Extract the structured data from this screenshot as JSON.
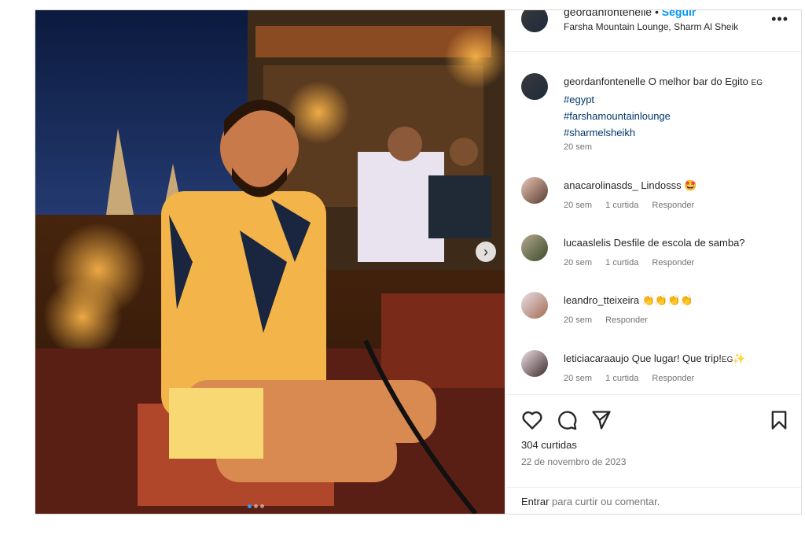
{
  "post": {
    "header": {
      "username": "geordanfontenelle",
      "separator": "•",
      "follow": "Seguir",
      "location": "Farsha Mountain Lounge, Sharm Al Sheik",
      "more_icon": "more-horizontal-icon"
    },
    "caption": {
      "username": "geordanfontenelle",
      "text": "O melhor bar do Egito",
      "flag": "EG",
      "tags": [
        "#egypt",
        "#farshamountainlounge",
        "#sharmelsheikh"
      ],
      "time": "20 sem"
    },
    "comments": [
      {
        "username": "anacarolinasds_",
        "text": "Lindosss",
        "emoji": "🤩",
        "time": "20 sem",
        "likes": "1 curtida",
        "reply": "Responder"
      },
      {
        "username": "lucaaslelis",
        "text": "Desfile de escola de samba?",
        "emoji": "",
        "time": "20 sem",
        "likes": "1 curtida",
        "reply": "Responder"
      },
      {
        "username": "leandro_tteixeira",
        "text": "",
        "emoji": "👏👏👏👏",
        "time": "20 sem",
        "likes": "",
        "reply": "Responder"
      },
      {
        "username": "leticiacaraaujo",
        "text": "Que lugar! Que trip!",
        "flag": "EG",
        "emoji": "✨",
        "time": "20 sem",
        "likes": "1 curtida",
        "reply": "Responder"
      }
    ],
    "actions": {
      "like_icon": "heart-icon",
      "comment_icon": "comment-icon",
      "share_icon": "send-icon",
      "save_icon": "bookmark-icon"
    },
    "likes": "304 curtidas",
    "date": "22 de novembro de 2023",
    "login": {
      "link": "Entrar",
      "text": "para curtir ou comentar."
    },
    "carousel": {
      "next_icon": "chevron-right-icon",
      "slide_count": 3,
      "active_slide": 1
    }
  }
}
